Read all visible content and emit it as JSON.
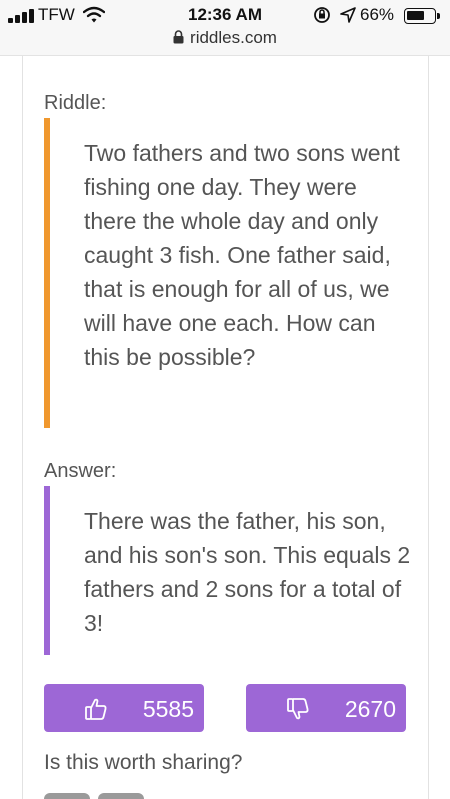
{
  "status_bar": {
    "carrier": "TFW",
    "time": "12:36 AM",
    "battery": "66%",
    "battery_level": 0.66,
    "icons": [
      "signal-icon",
      "wifi-icon",
      "orientation-lock-icon",
      "location-icon",
      "battery-icon"
    ]
  },
  "browser": {
    "url": "riddles.com",
    "lock_icon": "lock-icon"
  },
  "riddle": {
    "label": "Riddle:",
    "text": "Two fathers and two sons went fishing one day. They were there the whole day and only caught 3 fish. One father said, that is enough for all of us, we will have one each. How can this be possible?"
  },
  "answer": {
    "label": "Answer:",
    "text": "There was the father, his son, and his son's son. This equals 2 fathers and 2 sons for a total of 3!"
  },
  "votes": {
    "up_count": "5585",
    "down_count": "2670",
    "up_icon": "thumbs-up-icon",
    "down_icon": "thumbs-down-icon"
  },
  "share": {
    "question": "Is this worth sharing?"
  },
  "colors": {
    "riddle_accent": "#f0982e",
    "answer_accent": "#9d67d6",
    "button": "#9d67d6"
  }
}
